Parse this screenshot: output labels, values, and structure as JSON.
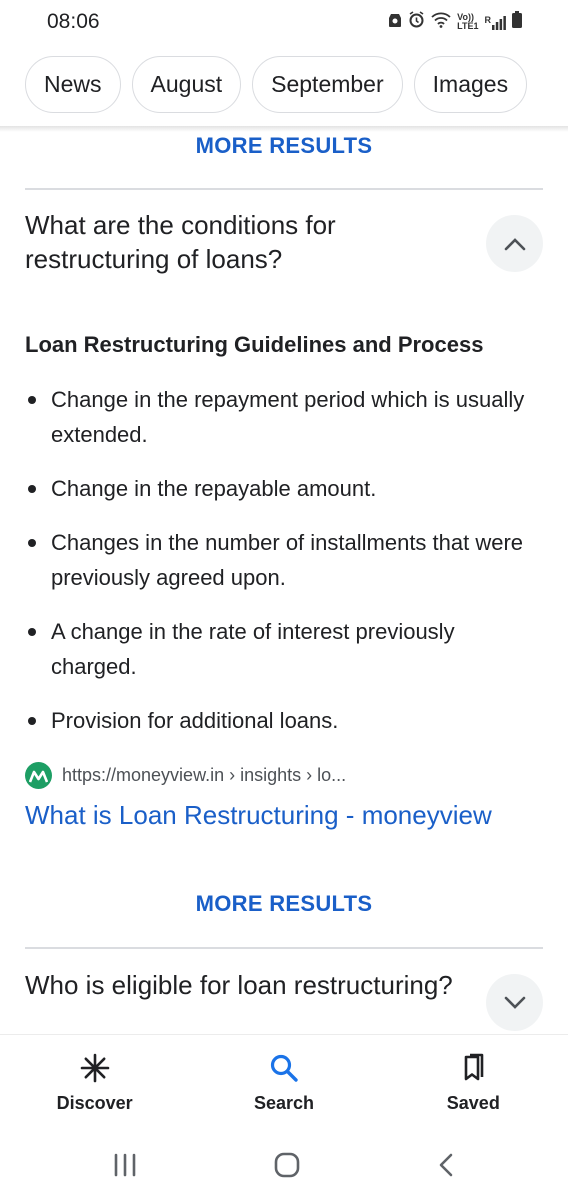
{
  "status_bar": {
    "time": "08:06",
    "volte_label": "Vo))",
    "lte_label": "LTE1",
    "roaming_label": "R"
  },
  "chips": [
    "News",
    "August",
    "September",
    "Images"
  ],
  "top_more_results": "MORE RESULTS",
  "question1": {
    "text": "What are the conditions for restructuring of loans?",
    "expanded": true
  },
  "answer": {
    "heading": "Loan Restructuring Guidelines and Process",
    "bullets": [
      "Change in the repayment period which is usually extended.",
      "Change in the repayable amount.",
      "Changes in the number of installments that were previously agreed upon.",
      "A change in the rate of interest previously charged.",
      "Provision for additional loans."
    ],
    "source_url": "https://moneyview.in › insights › lo...",
    "link_title": "What is Loan Restructuring - moneyview"
  },
  "bottom_more_results": "MORE RESULTS",
  "question2": {
    "text": "Who is eligible for loan restructuring?",
    "expanded": false
  },
  "bottom_nav": {
    "discover": "Discover",
    "search": "Search",
    "saved": "Saved"
  },
  "colors": {
    "link": "#1a5fc8",
    "active_nav": "#1a73e8",
    "favicon": "#1d9e64"
  }
}
